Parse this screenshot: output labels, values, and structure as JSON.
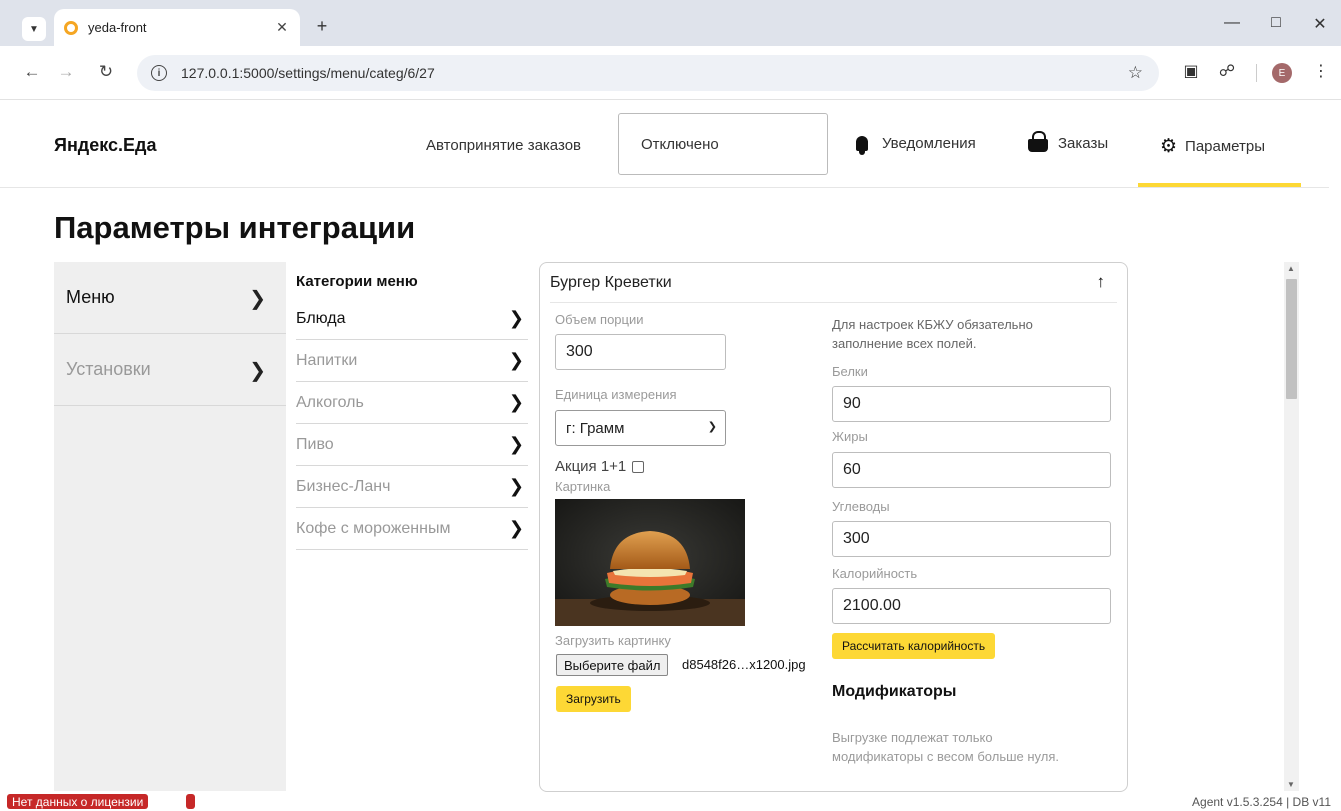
{
  "browser": {
    "tab_title": "yeda-front",
    "url": "127.0.0.1:5000/settings/menu/categ/6/27",
    "profile_initial": "E"
  },
  "header": {
    "brand": "Яндекс.Еда",
    "autoaccept_label": "Автопринятие заказов",
    "autoaccept_value": "Отключено",
    "nav": {
      "notifications": "Уведомления",
      "orders": "Заказы",
      "settings": "Параметры"
    },
    "accent_color": "#fdd835"
  },
  "page": {
    "title": "Параметры интеграции"
  },
  "leftnav": {
    "items": [
      {
        "label": "Меню"
      },
      {
        "label": "Установки"
      }
    ]
  },
  "categories": {
    "header": "Категории меню",
    "items": [
      {
        "label": "Блюда"
      },
      {
        "label": "Напитки"
      },
      {
        "label": "Алкоголь"
      },
      {
        "label": "Пиво"
      },
      {
        "label": "Бизнес-Ланч"
      },
      {
        "label": "Кофе с мороженным"
      }
    ]
  },
  "item": {
    "name": "Бургер Креветки",
    "portion_label": "Объем порции",
    "portion_value": "300",
    "unit_label": "Единица измерения",
    "unit_value": "г: Грамм",
    "promo_label": "Акция 1+1",
    "picture_label": "Картинка",
    "upload_picture_label": "Загрузить картинку",
    "choose_file_label": "Выберите файл",
    "file_name": "d8548f26…x1200.jpg",
    "upload_button": "Загрузить",
    "kbju_note_line1": "Для настроек КБЖУ обязательно",
    "kbju_note_line2": "заполнение всех полей.",
    "protein_label": "Белки",
    "protein_value": "90",
    "fat_label": "Жиры",
    "fat_value": "60",
    "carbs_label": "Углеводы",
    "carbs_value": "300",
    "calories_label": "Калорийность",
    "calories_value": "2100.00",
    "calc_button": "Рассчитать калорийность",
    "modifiers_title": "Модификаторы",
    "modifiers_note_line1": "Выгрузке подлежат только",
    "modifiers_note_line2": "модификаторы с весом больше нуля."
  },
  "status": {
    "license": "Нет данных о лицензии",
    "agent": "Agent v1.5.3.254   |   DB v11"
  }
}
